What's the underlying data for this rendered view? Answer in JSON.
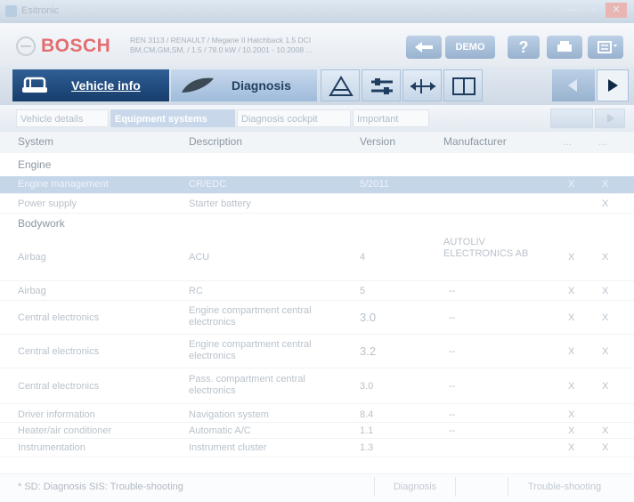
{
  "window": {
    "title": "Esitronic"
  },
  "header": {
    "brand": "BOSCH",
    "vehicle_line1": "REN 3113 / RENAULT / Megane II Hatchback 1.5 DCI",
    "vehicle_line2": "BM,CM,GM,SM, / 1.5 / 78.0 kW / 10.2001 - 10.2008 ...",
    "demo_label": "DEMO",
    "help_label": "?"
  },
  "tabs": {
    "vehicle_info": "Vehicle info",
    "diagnosis": "Diagnosis"
  },
  "subtabs": [
    "Vehicle details",
    "Equipment systems",
    "Diagnosis cockpit",
    "Important"
  ],
  "table": {
    "columns": {
      "system": "System",
      "description": "Description",
      "version": "Version",
      "manufacturer": "Manufacturer",
      "col5": "...",
      "col6": "..."
    },
    "groups": {
      "engine": "Engine",
      "bodywork": "Bodywork"
    },
    "engine_rows": [
      {
        "system": "Engine management",
        "description": "CR/EDC",
        "version": "5/2011",
        "manufacturer": "",
        "d": "X",
        "s": "X"
      },
      {
        "system": "Power supply",
        "description": "Starter battery",
        "version": "",
        "manufacturer": "",
        "d": "",
        "s": "X"
      }
    ],
    "body_rows": [
      {
        "system": "Airbag",
        "description": "ACU",
        "version": "4",
        "manufacturer": "AUTOLIV ELECTRONICS AB",
        "d": "X",
        "s": "X"
      },
      {
        "system": "Airbag",
        "description": "RC",
        "version": "5",
        "manufacturer": "--",
        "d": "X",
        "s": "X"
      },
      {
        "system": "Central electronics",
        "description": "Engine compartment central electronics",
        "version": "3.0",
        "manufacturer": "--",
        "d": "X",
        "s": "X"
      },
      {
        "system": "Central electronics",
        "description": "Engine compartment central electronics",
        "version": "3.2",
        "manufacturer": "--",
        "d": "X",
        "s": "X"
      },
      {
        "system": "Central electronics",
        "description": "Pass. compartment central electronics",
        "version": "3.0",
        "manufacturer": "--",
        "d": "X",
        "s": "X"
      },
      {
        "system": "Driver information",
        "description": "Navigation system",
        "version": "8.4",
        "manufacturer": "--",
        "d": "X",
        "s": ""
      },
      {
        "system": "Heater/air conditioner",
        "description": "Automatic A/C",
        "version": "1.1",
        "manufacturer": "--",
        "d": "X",
        "s": "X"
      },
      {
        "system": "Instrumentation",
        "description": "Instrument cluster",
        "version": "1.3",
        "manufacturer": "--",
        "d": "X",
        "s": "X"
      }
    ]
  },
  "footer": {
    "note": "* SD: Diagnosis  SIS: Trouble-shooting",
    "diagnosis_btn": "Diagnosis",
    "troubleshoot_btn": "Trouble-shooting"
  }
}
